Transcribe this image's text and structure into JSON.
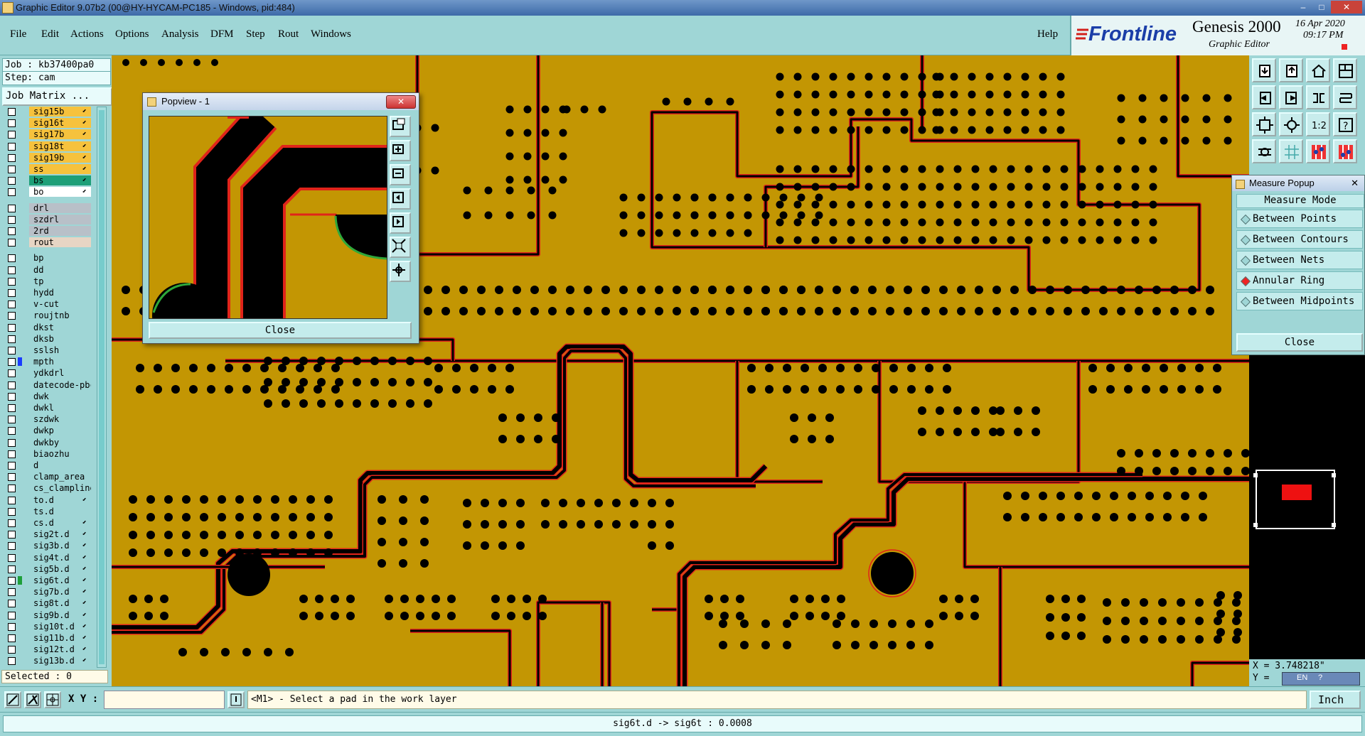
{
  "window": {
    "title": "Graphic Editor 9.07b2 (00@HY-HYCAM-PC185 - Windows, pid:484)",
    "controls": [
      "–",
      "□",
      "✕"
    ]
  },
  "menubar": {
    "items": [
      "File",
      "Edit",
      "Actions",
      "Options",
      "Analysis",
      "DFM",
      "Step",
      "Rout",
      "Windows"
    ],
    "help": "Help"
  },
  "logo": {
    "brand": "Frontline",
    "product": "Genesis 2000",
    "subtitle": "Graphic Editor",
    "date": "16 Apr 2020",
    "time": "09:17 PM"
  },
  "job": {
    "job_label": "Job : kb37400pa0",
    "step_label": "Step: cam",
    "matrix_button": "Job Matrix ..."
  },
  "layers": [
    {
      "name": "sig15b",
      "color": "#f6c23d",
      "arrow": true
    },
    {
      "name": "sig16t",
      "color": "#f6c23d",
      "arrow": true
    },
    {
      "name": "sig17b",
      "color": "#f6c23d",
      "arrow": true
    },
    {
      "name": "sig18t",
      "color": "#f6c23d",
      "arrow": true
    },
    {
      "name": "sig19b",
      "color": "#f6c23d",
      "arrow": true
    },
    {
      "name": "ss",
      "color": "#f6c23d",
      "arrow": true
    },
    {
      "name": "bs",
      "color": "#1e9f78",
      "arrow": true
    },
    {
      "name": "bo",
      "color": "#ffffff",
      "arrow": true
    },
    {
      "name": "drl",
      "color": "#b8c0c8",
      "arrow": false
    },
    {
      "name": "szdrl",
      "color": "#b8c0c8",
      "arrow": false
    },
    {
      "name": "2rd",
      "color": "#b8c0c8",
      "arrow": false
    },
    {
      "name": "rout",
      "color": "#e7d5c4",
      "arrow": false
    },
    {
      "name": "bp",
      "color": "#9fd6d6",
      "arrow": false
    },
    {
      "name": "dd",
      "color": "#9fd6d6",
      "arrow": false
    },
    {
      "name": "tp",
      "color": "#9fd6d6",
      "arrow": false
    },
    {
      "name": "hydd",
      "color": "#9fd6d6",
      "arrow": false
    },
    {
      "name": "v-cut",
      "color": "#9fd6d6",
      "arrow": false
    },
    {
      "name": "roujtnb",
      "color": "#9fd6d6",
      "arrow": false
    },
    {
      "name": "dkst",
      "color": "#9fd6d6",
      "arrow": false
    },
    {
      "name": "dksb",
      "color": "#9fd6d6",
      "arrow": false
    },
    {
      "name": "sslsh",
      "color": "#9fd6d6",
      "arrow": false
    },
    {
      "name": "mpth",
      "color": "#9fd6d6",
      "arrow": false,
      "swatch": "#1a3cff"
    },
    {
      "name": "ydkdrl",
      "color": "#9fd6d6",
      "arrow": false
    },
    {
      "name": "datecode-pbc",
      "color": "#9fd6d6",
      "arrow": false
    },
    {
      "name": "dwk",
      "color": "#9fd6d6",
      "arrow": false
    },
    {
      "name": "dwkl",
      "color": "#9fd6d6",
      "arrow": false
    },
    {
      "name": "szdwk",
      "color": "#9fd6d6",
      "arrow": false
    },
    {
      "name": "dwkp",
      "color": "#9fd6d6",
      "arrow": false
    },
    {
      "name": "dwkby",
      "color": "#9fd6d6",
      "arrow": false
    },
    {
      "name": "biaozhu",
      "color": "#9fd6d6",
      "arrow": false
    },
    {
      "name": "d",
      "color": "#9fd6d6",
      "arrow": false
    },
    {
      "name": "clamp_area",
      "color": "#9fd6d6",
      "arrow": false
    },
    {
      "name": "cs_clampline",
      "color": "#9fd6d6",
      "arrow": false
    },
    {
      "name": "to.d",
      "color": "#9fd6d6",
      "arrow": true
    },
    {
      "name": "ts.d",
      "color": "#9fd6d6",
      "arrow": false
    },
    {
      "name": "cs.d",
      "color": "#9fd6d6",
      "arrow": true
    },
    {
      "name": "sig2t.d",
      "color": "#9fd6d6",
      "arrow": true
    },
    {
      "name": "sig3b.d",
      "color": "#9fd6d6",
      "arrow": true
    },
    {
      "name": "sig4t.d",
      "color": "#9fd6d6",
      "arrow": true
    },
    {
      "name": "sig5b.d",
      "color": "#9fd6d6",
      "arrow": true
    },
    {
      "name": "sig6t.d",
      "color": "#9fd6d6",
      "arrow": true,
      "swatch": "#1e9f3a"
    },
    {
      "name": "sig7b.d",
      "color": "#9fd6d6",
      "arrow": true
    },
    {
      "name": "sig8t.d",
      "color": "#9fd6d6",
      "arrow": true
    },
    {
      "name": "sig9b.d",
      "color": "#9fd6d6",
      "arrow": true
    },
    {
      "name": "sig10t.d",
      "color": "#9fd6d6",
      "arrow": true
    },
    {
      "name": "sig11b.d",
      "color": "#9fd6d6",
      "arrow": true
    },
    {
      "name": "sig12t.d",
      "color": "#9fd6d6",
      "arrow": true
    },
    {
      "name": "sig13b.d",
      "color": "#9fd6d6",
      "arrow": true
    }
  ],
  "selected": "Selected : 0",
  "popview": {
    "title": "Popview - 1",
    "close": "Close",
    "tool_icons": [
      "zoom-window-icon",
      "zoom-in-icon",
      "zoom-out-icon",
      "pan-left-icon",
      "pan-right-icon",
      "fit-icon",
      "center-icon"
    ]
  },
  "measure": {
    "title": "Measure Popup",
    "header": "Measure Mode",
    "modes": [
      "Between Points",
      "Between Contours",
      "Between Nets",
      "Annular Ring",
      "Between Midpoints"
    ],
    "selected": "Annular Ring",
    "close": "Close"
  },
  "coords": {
    "x_label": "X = 3.748218\"",
    "y_label": "Y ="
  },
  "bottom": {
    "xy_label": "X Y :",
    "xy_value": "",
    "prompt": "<M1> - Select a pad in the work layer",
    "units": "Inch"
  },
  "status": "sig6t.d -> sig6t : 0.0008",
  "colors": {
    "board": "#c39603",
    "trace": "#000000",
    "outline": "#e0241a",
    "panel": "#9fd6d6"
  }
}
